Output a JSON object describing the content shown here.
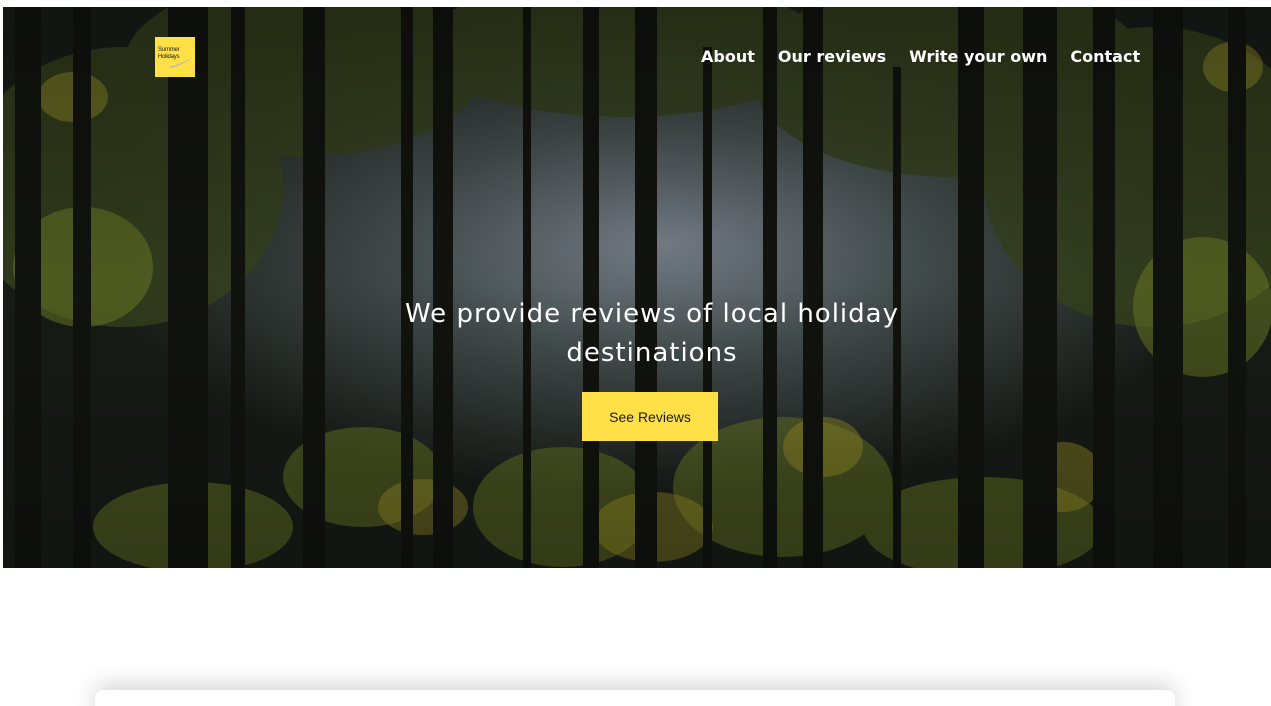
{
  "logo": {
    "line1": "Summer",
    "line2": "Holidays",
    "brand_color": "#ffe047"
  },
  "nav": {
    "items": [
      {
        "label": "About"
      },
      {
        "label": "Our reviews"
      },
      {
        "label": "Write your own"
      },
      {
        "label": "Contact"
      }
    ]
  },
  "hero": {
    "heading": "We provide reviews of local holiday destinations",
    "button_label": "See Reviews",
    "background": "forest-photo",
    "accent_color": "#ffe047"
  }
}
